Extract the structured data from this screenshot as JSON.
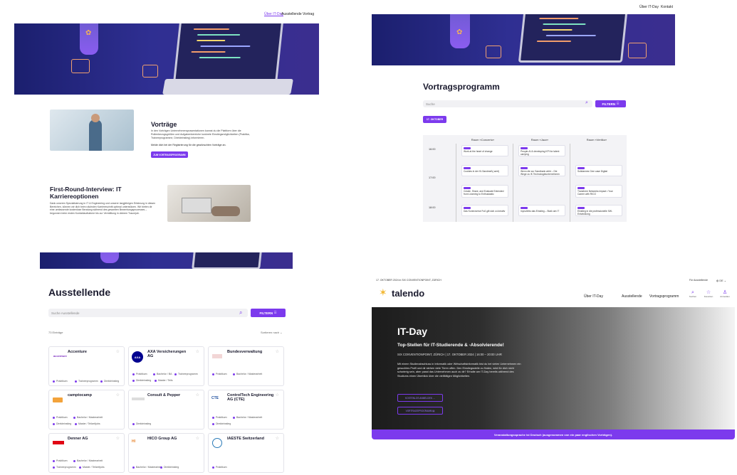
{
  "panel1": {
    "nav": [
      "Über IT-Day",
      "Ausstellende",
      "Vortrag"
    ],
    "talks": {
      "title": "Vorträge",
      "body": "In den Vorträgen Unternehmensprasentationen kannst du die Plattform über die Rollenbezugsgrößen und Aufgabenbereiche konkrete Einstiegsmöglichkeiten (Praktika, Traineeprogramme, Direkteinstieg) informieren.",
      "note": "Melde dich bei der Registrierung für die gewünschten Vorträge an.",
      "button": "ZUM VORTRAGSPROGRAMM"
    },
    "interview": {
      "title": "First-Round-Interview: IT Karriereoptionen",
      "body": "Dank unseren Spezialisierung in IT & Engineering und unserer langjährigen Erfahrung in diesen Bereichen, können wir dich beim nächsten Karriereschritt optimal unterstützen. Wir bieten dir eine umfassende kostenlose Beratung während des gesamten Bewerbungsprozesses – begonnen beim ersten Kontaktaufnahme bis zur Vermittlung in deinem Traumjob."
    }
  },
  "panel2": {
    "nav": [
      "Über IT-Day",
      "Kontakt"
    ],
    "title": "Vortragsprogramm",
    "search_placeholder": "Suche",
    "filter_label": "FILTERN",
    "date_chip": "17. OKTOBER",
    "rooms": [
      "Raum «Concerto»",
      "Raum «Jazz»",
      "Raum «Vertiko»"
    ],
    "times": [
      "16:00",
      "17:00",
      "18:00"
    ],
    "slots": [
      [
        "Work at the heart of change",
        "People-AI & developing KPI for talent carrying",
        ""
      ],
      [
        "Cookies in der KI-Sandmeß(-wert)",
        "Wenn die zur Sandbank wirkt – Die Wege zu IK Technologieunternehmen",
        "Solidannes Cine case Digital"
      ],
      [
        "Create, Share, and Evaluate Extended from Learning to Enthusiastic",
        "",
        "Transform Networks impact • Your Career with RICO"
      ],
      [
        "Das Kontroverse Fuß gilt sich zu kreativ",
        "Inpro/ditto das Einstieg – Stark am IT",
        "Einstieg in die professionelle SW-Entwicklung"
      ]
    ]
  },
  "panel3": {
    "title": "Ausstellende",
    "search_placeholder": "Suche Ausstellende",
    "filter_label": "FILTERN",
    "count": "73 Einträge",
    "sort": "Sortieren nach",
    "exhibitors": [
      {
        "name": "Accenture",
        "tags": [
          "Praktikum",
          "Traineeprogramm",
          "Direkteinstieg"
        ]
      },
      {
        "name": "AXA Versicherungen AG",
        "tags": [
          "Praktikum",
          "Bachelor / BA",
          "Traineeprogramm",
          "Direkteinstieg",
          "Master / Teils"
        ]
      },
      {
        "name": "Bundesverwaltung",
        "tags": [
          "Praktikum",
          "Bachelor / Masterarbeit"
        ]
      },
      {
        "name": "camptocamp",
        "tags": [
          "Praktikum",
          "Bachelor / Masterarbeit",
          "Direkteinstieg",
          "Master / Teilzeitjobs"
        ]
      },
      {
        "name": "Consult & Pepper",
        "tags": [
          "Direkteinstieg"
        ]
      },
      {
        "name": "ControlTech Engineering AG (CTE)",
        "tags": [
          "Praktikum",
          "Bachelor / Masterarbeit",
          "Direkteinstieg"
        ]
      },
      {
        "name": "Denner AG",
        "tags": [
          "Praktikum",
          "Bachelor / Masterarbeit",
          "Traineeprogramm",
          "Master / Teilzeitjobs"
        ]
      },
      {
        "name": "HICO Group AG",
        "tags": [
          "Bachelor / Masterarbeit",
          "Direkteinstieg"
        ]
      },
      {
        "name": "IAESTE Switzerland",
        "tags": [
          "Praktikum"
        ]
      }
    ]
  },
  "panel4": {
    "topbar": "17. OKTOBER 2024 in SIX CONVENTIONPOINT, ZÜRICH",
    "top_links": [
      "Für Ausstellende",
      "DE"
    ],
    "brand": "talendo",
    "nav": [
      "Über IT-Day",
      "Ausstellende",
      "Vortragsprogramm"
    ],
    "icons": [
      {
        "icon": "search-icon",
        "label": "Suchen"
      },
      {
        "icon": "star-icon",
        "label": "Favoriten"
      },
      {
        "icon": "user-icon",
        "label": "Anmelden"
      }
    ],
    "hero": {
      "title": "IT-Day",
      "subtitle": "Top-Stellen für IT-Studierende & -Absolvierende!",
      "date": "SIX CONVENTIONPOINT, ZÜRICH | 17. OKTOBER 2024 | 16:00 – 20:00 UHR",
      "body": "Mit einem Studienabschluss in Informatik oder Wirtschaftsinformatik bist du bei vielen Unternehmen ein gesuchtes Profil und dir stehen viele Türen offen. Den Einstiegsstelle zu finden, wird für dich nicht schwierig sein, aber passt das Unternehmen auch zu dir? Erhalte am IT-Day bereits während des Studiums einen Überblick über die vielfältigen Möglichkeiten.",
      "btn1": "KOSTENLOS ANMELDEN",
      "btn2": "VORTRAGSPROGRAMM"
    },
    "banner": "Veranstaltungssprache ist Deutsch (ausgenommen von ein paar englischen Vorträgen)."
  },
  "colors": {
    "accent": "#7c3aed",
    "hero_dark": "#1b1f6e"
  }
}
